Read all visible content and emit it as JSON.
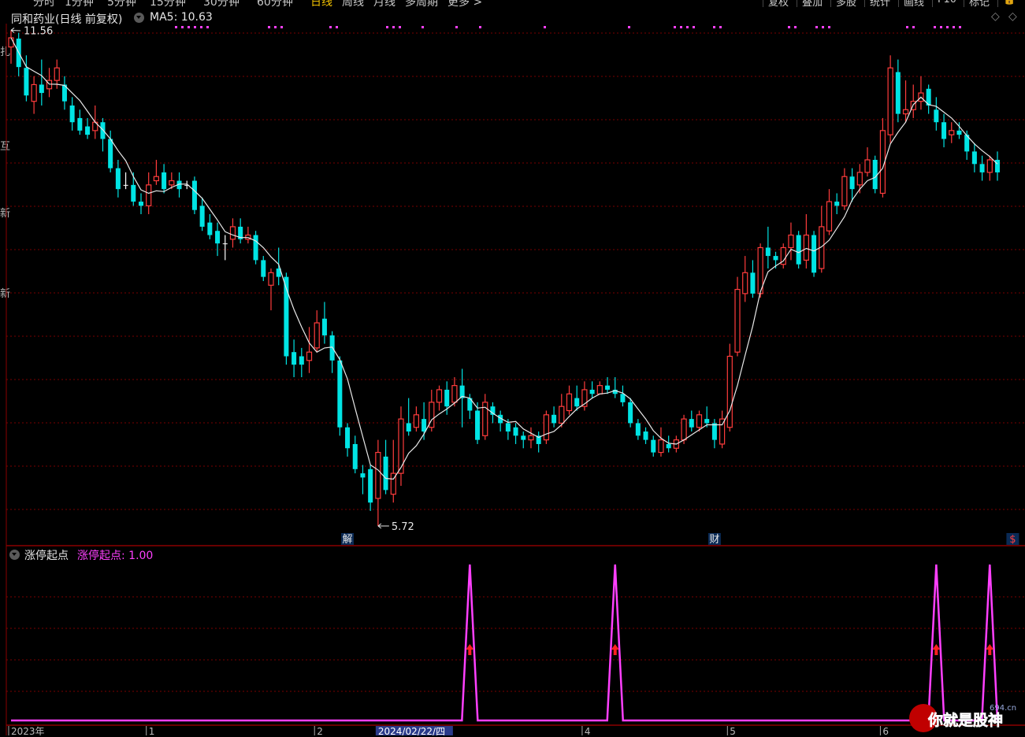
{
  "toolbar": {
    "periods": [
      {
        "label": "分时",
        "active": false
      },
      {
        "label": "1分钟",
        "active": false
      },
      {
        "label": "5分钟",
        "active": false
      },
      {
        "label": "15分钟",
        "active": false
      },
      {
        "label": "30分钟",
        "active": false
      },
      {
        "label": "60分钟",
        "active": false
      },
      {
        "label": "日线",
        "active": true
      },
      {
        "label": "周线",
        "active": false
      },
      {
        "label": "月线",
        "active": false
      },
      {
        "label": "多周期",
        "active": false
      },
      {
        "label": "更多 >",
        "active": false
      }
    ],
    "buttons": [
      "复权",
      "叠加",
      "多股",
      "统计",
      "画线",
      "F10",
      "标记",
      "🔒"
    ]
  },
  "header": {
    "title": "同和药业(日线 前复权)",
    "ma_label": "MA5: 10.63"
  },
  "indicator": {
    "name": "涨停起点",
    "value_label": "涨停起点: 1.00"
  },
  "price_annotations": {
    "high_label": "11.56",
    "low_label": "5.72"
  },
  "event_markers": [
    {
      "label": "解",
      "index": 44
    },
    {
      "label": "财",
      "index": 92
    },
    {
      "label": "$",
      "index": 131
    }
  ],
  "x_axis": {
    "labels": [
      {
        "label": "2023年",
        "index": 0
      },
      {
        "label": "1",
        "index": 18
      },
      {
        "label": "2",
        "index": 40
      },
      {
        "label": "2024/02/22/四",
        "index": 48,
        "highlight": true
      },
      {
        "label": "4",
        "index": 75
      },
      {
        "label": "5",
        "index": 94
      },
      {
        "label": "6",
        "index": 114
      }
    ]
  },
  "side_labels": [
    "扎",
    "互",
    "新",
    "新"
  ],
  "watermark": {
    "site": "694.cn",
    "text": "你就是股神"
  },
  "colors": {
    "up": "#ff3c3c",
    "down": "#00e4e4",
    "ma": "#e8e8e8",
    "indicator": "#ff40ff",
    "grid": "#7a0000",
    "signal": "#ff2020"
  },
  "chart_data": {
    "type": "candlestick",
    "ylim": [
      5.3,
      12.0
    ],
    "series": [
      {
        "name": "MA5"
      }
    ],
    "candles": [
      [
        11.45,
        11.56,
        11.65,
        11.25
      ],
      [
        11.55,
        11.21,
        11.62,
        11.1
      ],
      [
        11.2,
        10.87,
        11.35,
        10.8
      ],
      [
        10.8,
        11.0,
        11.1,
        10.65
      ],
      [
        11.0,
        10.9,
        11.3,
        10.75
      ],
      [
        10.95,
        11.05,
        11.2,
        10.85
      ],
      [
        11.05,
        11.2,
        11.3,
        10.95
      ],
      [
        11.0,
        10.8,
        11.1,
        10.7
      ],
      [
        10.75,
        10.55,
        10.85,
        10.45
      ],
      [
        10.6,
        10.45,
        10.7,
        10.4
      ],
      [
        10.5,
        10.4,
        10.6,
        10.35
      ],
      [
        10.45,
        10.55,
        10.75,
        10.35
      ],
      [
        10.55,
        10.35,
        10.6,
        10.2
      ],
      [
        10.35,
        10.0,
        10.45,
        9.95
      ],
      [
        10.0,
        9.75,
        10.1,
        9.65
      ],
      [
        9.8,
        9.8,
        9.95,
        9.75
      ],
      [
        9.8,
        9.6,
        9.95,
        9.55
      ],
      [
        9.6,
        9.55,
        9.7,
        9.45
      ],
      [
        9.55,
        9.8,
        9.95,
        9.45
      ],
      [
        9.85,
        9.9,
        10.1,
        9.8
      ],
      [
        9.95,
        9.75,
        10.05,
        9.7
      ],
      [
        9.8,
        9.85,
        9.95,
        9.75
      ],
      [
        9.85,
        9.75,
        9.95,
        9.65
      ],
      [
        9.8,
        9.8,
        9.85,
        9.75
      ],
      [
        9.85,
        9.5,
        9.9,
        9.45
      ],
      [
        9.55,
        9.3,
        9.65,
        9.25
      ],
      [
        9.35,
        9.2,
        9.45,
        9.15
      ],
      [
        9.25,
        9.1,
        9.35,
        8.95
      ],
      [
        9.1,
        9.1,
        9.2,
        8.9
      ],
      [
        9.15,
        9.3,
        9.4,
        9.05
      ],
      [
        9.3,
        9.15,
        9.4,
        9.1
      ],
      [
        9.15,
        9.2,
        9.3,
        9.1
      ],
      [
        9.2,
        8.9,
        9.25,
        8.85
      ],
      [
        8.9,
        8.7,
        8.95,
        8.65
      ],
      [
        8.6,
        8.75,
        8.8,
        8.3
      ],
      [
        8.8,
        8.7,
        9.05,
        8.6
      ],
      [
        8.7,
        7.75,
        8.75,
        7.65
      ],
      [
        7.8,
        7.65,
        7.95,
        7.5
      ],
      [
        7.75,
        7.65,
        7.85,
        7.5
      ],
      [
        7.7,
        7.8,
        8.1,
        7.55
      ],
      [
        7.85,
        8.15,
        8.3,
        7.8
      ],
      [
        8.2,
        8.0,
        8.4,
        7.9
      ],
      [
        8.0,
        7.7,
        8.05,
        7.55
      ],
      [
        7.7,
        6.9,
        7.75,
        6.8
      ],
      [
        6.9,
        6.65,
        6.95,
        6.55
      ],
      [
        6.7,
        6.4,
        6.8,
        6.35
      ],
      [
        6.35,
        6.3,
        6.45,
        6.1
      ],
      [
        6.4,
        6.0,
        6.45,
        5.9
      ],
      [
        6.05,
        6.6,
        6.75,
        5.72
      ],
      [
        6.55,
        6.15,
        6.75,
        6.1
      ],
      [
        6.1,
        6.35,
        6.75,
        6.0
      ],
      [
        6.35,
        7.0,
        7.15,
        6.2
      ],
      [
        6.95,
        6.85,
        7.25,
        6.8
      ],
      [
        6.9,
        7.05,
        7.15,
        6.85
      ],
      [
        7.0,
        6.85,
        7.2,
        6.75
      ],
      [
        6.9,
        7.2,
        7.35,
        6.85
      ],
      [
        7.2,
        7.35,
        7.4,
        7.1
      ],
      [
        7.35,
        7.15,
        7.45,
        7.05
      ],
      [
        7.2,
        7.4,
        7.5,
        7.15
      ],
      [
        7.4,
        7.25,
        7.6,
        6.9
      ],
      [
        7.25,
        7.1,
        7.3,
        7.0
      ],
      [
        7.1,
        6.75,
        7.2,
        6.7
      ],
      [
        6.8,
        7.2,
        7.3,
        6.75
      ],
      [
        7.15,
        7.05,
        7.2,
        6.95
      ],
      [
        7.05,
        6.95,
        7.1,
        6.85
      ],
      [
        6.95,
        6.85,
        7.0,
        6.75
      ],
      [
        6.9,
        6.8,
        6.95,
        6.7
      ],
      [
        6.8,
        6.75,
        6.85,
        6.65
      ],
      [
        6.75,
        6.8,
        6.9,
        6.65
      ],
      [
        6.8,
        6.7,
        6.85,
        6.6
      ],
      [
        6.75,
        7.05,
        7.1,
        6.7
      ],
      [
        7.05,
        6.95,
        7.15,
        6.9
      ],
      [
        6.95,
        7.15,
        7.3,
        6.9
      ],
      [
        7.1,
        7.3,
        7.4,
        7.05
      ],
      [
        7.25,
        7.15,
        7.4,
        7.1
      ],
      [
        7.15,
        7.35,
        7.45,
        7.1
      ],
      [
        7.35,
        7.3,
        7.45,
        7.25
      ],
      [
        7.3,
        7.4,
        7.45,
        7.3
      ],
      [
        7.4,
        7.35,
        7.5,
        7.3
      ],
      [
        7.35,
        7.3,
        7.5,
        7.25
      ],
      [
        7.3,
        7.2,
        7.4,
        7.15
      ],
      [
        7.2,
        6.95,
        7.25,
        6.9
      ],
      [
        6.95,
        6.8,
        7.0,
        6.75
      ],
      [
        6.85,
        6.75,
        6.9,
        6.7
      ],
      [
        6.75,
        6.6,
        6.8,
        6.55
      ],
      [
        6.6,
        6.75,
        6.9,
        6.55
      ],
      [
        6.7,
        6.65,
        6.8,
        6.6
      ],
      [
        6.65,
        6.75,
        6.8,
        6.6
      ],
      [
        6.75,
        7.0,
        7.05,
        6.7
      ],
      [
        7.0,
        6.9,
        7.1,
        6.85
      ],
      [
        6.9,
        7.05,
        7.1,
        6.85
      ],
      [
        7.0,
        6.95,
        7.15,
        6.9
      ],
      [
        6.95,
        6.75,
        7.0,
        6.65
      ],
      [
        6.7,
        7.0,
        7.1,
        6.65
      ],
      [
        6.9,
        7.75,
        7.9,
        6.85
      ],
      [
        7.8,
        8.55,
        8.7,
        7.75
      ],
      [
        8.5,
        8.75,
        8.95,
        8.4
      ],
      [
        8.75,
        8.5,
        8.9,
        8.45
      ],
      [
        8.5,
        9.05,
        9.1,
        8.45
      ],
      [
        9.05,
        8.95,
        9.3,
        8.8
      ],
      [
        8.95,
        8.9,
        9.0,
        8.8
      ],
      [
        8.85,
        9.05,
        9.1,
        8.8
      ],
      [
        9.05,
        9.2,
        9.35,
        8.9
      ],
      [
        9.2,
        8.85,
        9.25,
        8.8
      ],
      [
        8.9,
        9.2,
        9.45,
        8.8
      ],
      [
        9.2,
        8.75,
        9.25,
        8.7
      ],
      [
        8.8,
        9.3,
        9.55,
        8.75
      ],
      [
        9.25,
        9.6,
        9.75,
        9.2
      ],
      [
        9.6,
        9.55,
        9.7,
        9.45
      ],
      [
        9.55,
        9.9,
        10.0,
        9.5
      ],
      [
        9.9,
        9.75,
        10.0,
        9.6
      ],
      [
        9.8,
        9.95,
        10.05,
        9.7
      ],
      [
        9.95,
        10.1,
        10.25,
        9.9
      ],
      [
        10.1,
        9.75,
        10.15,
        9.7
      ],
      [
        9.7,
        10.45,
        10.6,
        9.65
      ],
      [
        10.4,
        11.2,
        11.35,
        10.3
      ],
      [
        11.15,
        10.65,
        11.3,
        10.55
      ],
      [
        10.65,
        10.7,
        11.05,
        10.55
      ],
      [
        10.7,
        10.8,
        11.0,
        10.6
      ],
      [
        10.8,
        10.9,
        11.1,
        10.7
      ],
      [
        10.95,
        10.75,
        11.0,
        10.65
      ],
      [
        10.7,
        10.55,
        10.85,
        10.45
      ],
      [
        10.55,
        10.35,
        10.65,
        10.25
      ],
      [
        10.4,
        10.45,
        10.55,
        10.3
      ],
      [
        10.45,
        10.4,
        10.55,
        10.35
      ],
      [
        10.4,
        10.2,
        10.45,
        10.1
      ],
      [
        10.2,
        10.05,
        10.3,
        9.95
      ],
      [
        10.05,
        9.95,
        10.15,
        9.85
      ],
      [
        9.95,
        10.1,
        10.15,
        9.85
      ],
      [
        10.1,
        9.95,
        10.2,
        9.85
      ]
    ],
    "indicator_values": [
      0,
      0,
      0,
      0,
      0,
      0,
      0,
      0,
      0,
      0,
      0,
      0,
      0,
      0,
      0,
      0,
      0,
      0,
      0,
      0,
      0,
      0,
      0,
      0,
      0,
      0,
      0,
      0,
      0,
      0,
      0,
      0,
      0,
      0,
      0,
      0,
      0,
      0,
      0,
      0,
      0,
      0,
      0,
      0,
      0,
      0,
      0,
      0,
      0,
      0,
      0,
      0,
      0,
      0,
      0,
      0,
      0,
      0,
      0,
      0,
      1,
      0,
      0,
      0,
      0,
      0,
      0,
      0,
      0,
      0,
      0,
      0,
      0,
      0,
      0,
      0,
      0,
      0,
      0,
      0,
      0,
      0,
      0,
      0,
      0,
      0,
      0,
      0,
      0,
      0,
      0,
      0,
      0,
      0,
      0,
      0,
      0,
      0,
      0,
      0,
      0,
      0,
      0,
      0,
      0,
      0,
      0,
      0,
      0,
      0,
      0,
      0,
      0,
      0,
      0,
      0,
      0,
      0,
      0,
      0,
      0,
      0,
      0,
      0,
      0,
      0,
      0,
      0,
      0,
      0,
      0,
      0,
      0,
      0,
      0,
      0,
      0,
      0,
      0,
      0
    ],
    "indicator_peaks": [
      60,
      79,
      121,
      128
    ]
  }
}
